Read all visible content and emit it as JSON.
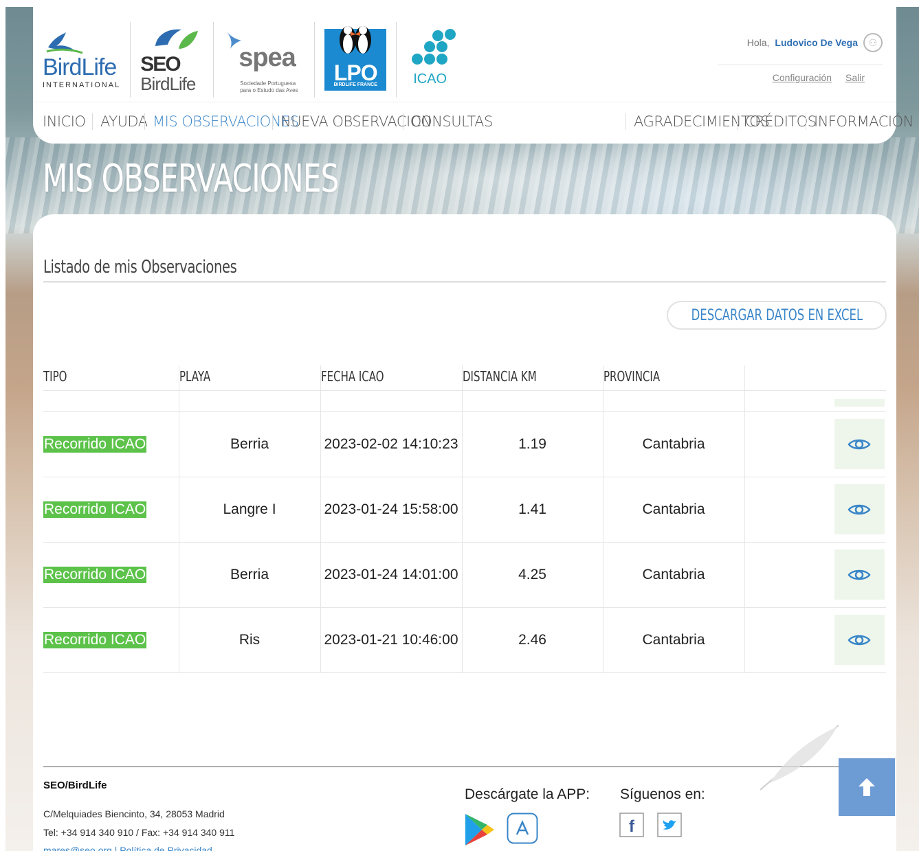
{
  "header": {
    "logos": {
      "birdlife": {
        "name": "BirdLife",
        "sub": "INTERNATIONAL"
      },
      "seo": {
        "line1": "SEO",
        "line2": "BirdLife"
      },
      "spea": {
        "name": "spea",
        "sub1": "Sociedade Portuguesa",
        "sub2": "para o Estudo das Aves"
      },
      "lpo": {
        "name": "LPO",
        "sub": "BIRDLIFE FRANCE"
      },
      "icao": {
        "name": "ICAO"
      }
    },
    "user": {
      "greeting": "Hola,",
      "name": "Ludovico De Vega",
      "config_label": "Configuración",
      "logout_label": "Salir"
    }
  },
  "nav": {
    "left": [
      "INICIO",
      "AYUDA",
      "MIS OBSERVACIONES",
      "NUEVA OBSERVACION",
      "CONSULTAS"
    ],
    "right": [
      "AGRADECIMIENTOS",
      "CRÉDITOS",
      "INFORMACIÓN"
    ],
    "active": "MIS OBSERVACIONES"
  },
  "page_title": "MIS OBSERVACIONES",
  "main": {
    "section_title": "Listado de mis Observaciones",
    "excel_button": "DESCARGAR DATOS EN EXCEL",
    "table": {
      "headers": [
        "TIPO",
        "PLAYA",
        "FECHA ICAO",
        "DISTANCIA KM",
        "PROVINCIA",
        ""
      ],
      "rows": [
        {
          "tipo": "Recorrido ICAO",
          "playa": "Berria",
          "fecha": "2023-02-02 14:10:23",
          "distancia": "1.19",
          "provincia": "Cantabria"
        },
        {
          "tipo": "Recorrido ICAO",
          "playa": "Langre I",
          "fecha": "2023-01-24 15:58:00",
          "distancia": "1.41",
          "provincia": "Cantabria"
        },
        {
          "tipo": "Recorrido ICAO",
          "playa": "Berria",
          "fecha": "2023-01-24 14:01:00",
          "distancia": "4.25",
          "provincia": "Cantabria"
        },
        {
          "tipo": "Recorrido ICAO",
          "playa": "Ris",
          "fecha": "2023-01-21 10:46:00",
          "distancia": "2.46",
          "provincia": "Cantabria"
        }
      ]
    }
  },
  "footer": {
    "org": "SEO/BirdLife",
    "address": "C/Melquiades Biencinto, 34, 28053 Madrid",
    "phone": "Tel: +34 914 340 910 / Fax: +34 914 340 911",
    "links": "mares@seo.org | Política de Privacidad",
    "app_label": "Descárgate la APP:",
    "follow_label": "Síguenos en:"
  },
  "icons": {
    "view": "eye-icon",
    "user": "user-circle-icon",
    "scroll_top": "arrow-up-icon",
    "google_play": "google-play-icon",
    "app_store": "app-store-icon",
    "facebook": "facebook-icon",
    "twitter": "twitter-icon"
  },
  "colors": {
    "accent": "#3a86c8",
    "badge": "#5cc24a",
    "eye_bg": "#eef6ec",
    "top_button": "#6d9bd4"
  }
}
